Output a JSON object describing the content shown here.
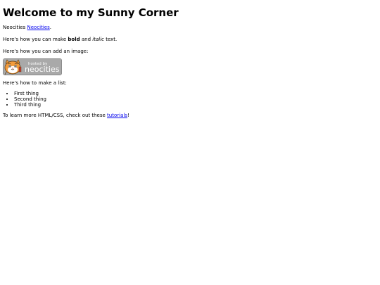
{
  "page": {
    "heading": "Welcome to my Sunny Corner",
    "intro": {
      "prefix": "Neocities ",
      "link_text": "Neocities",
      "suffix": "."
    },
    "formatting": {
      "prefix": "Here's how you can make ",
      "bold_text": "bold",
      "middle": " and ",
      "italic_text": "italic",
      "suffix": " text."
    },
    "image_intro": "Here's how you can add an image:",
    "badge": {
      "small_text": "hosted by",
      "brand_text": "neocities",
      "colors": {
        "background": "#a9a9a9",
        "text": "#ffffff",
        "cat": "#f39c3d"
      }
    },
    "list_intro": "Here's how to make a list:",
    "list_items": [
      "First thing",
      "Second thing",
      "Third thing"
    ],
    "outro": {
      "prefix": "To learn more HTML/CSS, check out these ",
      "link_text": "tutorials",
      "suffix": "!"
    }
  }
}
